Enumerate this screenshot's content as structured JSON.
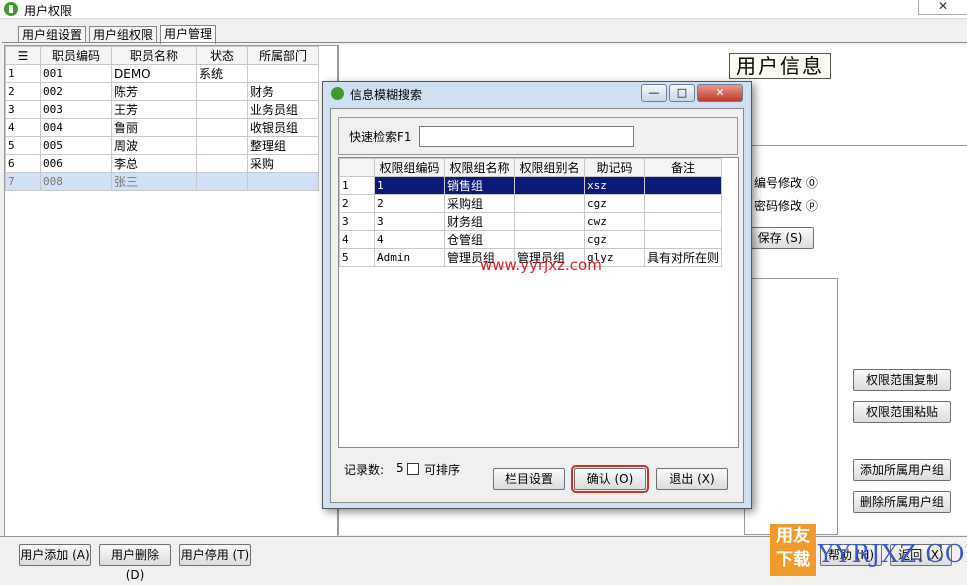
{
  "window": {
    "title": "用户权限",
    "close": "✕"
  },
  "tabs": [
    "用户组设置",
    "用户组权限",
    "用户管理"
  ],
  "employees": {
    "columns": [
      "职员编码",
      "职员名称",
      "状态",
      "所属部门"
    ],
    "rows": [
      {
        "n": "1",
        "code": "001",
        "name": "DEMO",
        "status": "系统",
        "dept": ""
      },
      {
        "n": "2",
        "code": "002",
        "name": "陈芳",
        "status": "",
        "dept": "财务"
      },
      {
        "n": "3",
        "code": "003",
        "name": "王芳",
        "status": "",
        "dept": "业务员组"
      },
      {
        "n": "4",
        "code": "004",
        "name": "鲁丽",
        "status": "",
        "dept": "收银员组"
      },
      {
        "n": "5",
        "code": "005",
        "name": "周波",
        "status": "",
        "dept": "整理组"
      },
      {
        "n": "6",
        "code": "006",
        "name": "李总",
        "status": "",
        "dept": "采购"
      },
      {
        "n": "7",
        "code": "008",
        "name": "张三",
        "status": "",
        "dept": ""
      }
    ]
  },
  "right": {
    "user_info": "用户信息",
    "edit_no": "编号修改 ⓪",
    "edit_pwd": "密码修改 ⓟ",
    "save": "保存 (S)",
    "copy_scope": "权限范围复制",
    "paste_scope": "权限范围粘贴",
    "add_group": "添加所属用户组",
    "del_group": "删除所属用户组"
  },
  "bottom": {
    "add_user": "用户添加 (A)",
    "del_user": "用户删除 (D)",
    "disable_user": "用户停用 (T)",
    "help": "帮助 (H)",
    "back": "返回 (X)"
  },
  "dialog": {
    "title": "信息模糊搜索",
    "min": "—",
    "max": "□",
    "close": "✕",
    "search_label": "快速检索F1",
    "search_value": "",
    "columns": [
      "权限组编码",
      "权限组名称",
      "权限组别名",
      "助记码",
      "备注"
    ],
    "rows": [
      {
        "n": "1",
        "code": "1",
        "name": "销售组",
        "alias": "",
        "mnemonic": "xsz",
        "note": ""
      },
      {
        "n": "2",
        "code": "2",
        "name": "采购组",
        "alias": "",
        "mnemonic": "cgz",
        "note": ""
      },
      {
        "n": "3",
        "code": "3",
        "name": "财务组",
        "alias": "",
        "mnemonic": "cwz",
        "note": ""
      },
      {
        "n": "4",
        "code": "4",
        "name": "仓管组",
        "alias": "",
        "mnemonic": "cgz",
        "note": ""
      },
      {
        "n": "5",
        "code": "Admin",
        "name": "管理员组",
        "alias": "管理员组",
        "mnemonic": "glyz",
        "note": "具有对所在则"
      }
    ],
    "record_label": "记录数:",
    "record_count": "5",
    "sortable": "可排序",
    "col_setup": "栏目设置",
    "confirm": "确认 (O)",
    "exit": "退出 (X)"
  },
  "watermark": "www.yyrjxz.com",
  "logo": {
    "line1": "用友",
    "line2": "下载",
    "text": "YYRJXZ.COM"
  },
  "colors": {
    "selection": "#0b1978",
    "watermark": "#e02020",
    "confirm_border": "#d03030"
  }
}
